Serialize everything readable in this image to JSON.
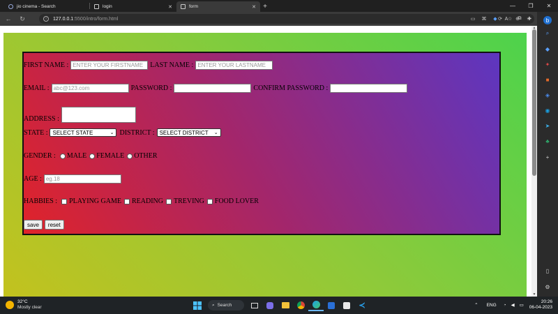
{
  "browser": {
    "tabs": [
      {
        "label": "jio cinema - Search",
        "active": false
      },
      {
        "label": "login",
        "active": false
      },
      {
        "label": "form",
        "active": true
      }
    ],
    "url_host": "127.0.0.1",
    "url_rest": ":5500/intro/form.html"
  },
  "form": {
    "first_name_label": "FIRST NAME :",
    "first_name_placeholder": "ENTER YOUR FIRSTNAME",
    "last_name_label": "LAST NAME :",
    "last_name_placeholder": "ENTER YOUR  LASTNAME",
    "email_label": "EMAIL :",
    "email_placeholder": "abc@123.com",
    "password_label": "PASSWORD :",
    "confirm_password_label": "CONFIRM PASSWORD :",
    "address_label": "ADDRESS :",
    "state_label": "STATE :",
    "state_selected": "SELECT STATE",
    "district_label": "DISTRICT :",
    "district_selected": "SELECT DISTRICT",
    "gender_label": "GENDER :",
    "gender_options": [
      "MALE",
      "FEMALE",
      "OTHER"
    ],
    "age_label": "AGE :",
    "age_placeholder": "eg.18",
    "hobbies_label": "HABBIES :",
    "hobbies_options": [
      "PLAYING GAME",
      "READING",
      "TREVING",
      "FOOD LOVER"
    ],
    "save_label": "save",
    "reset_label": "reset"
  },
  "taskbar": {
    "temperature": "32°C",
    "weather": "Mostly clear",
    "search_label": "Search",
    "language": "ENG",
    "time": "20:26",
    "date": "06-04-2023"
  },
  "colors": {
    "page_gradient": [
      "#c3c21e",
      "#4dd34c"
    ],
    "form_gradient": [
      "#e0232a",
      "#5d36c0"
    ]
  }
}
